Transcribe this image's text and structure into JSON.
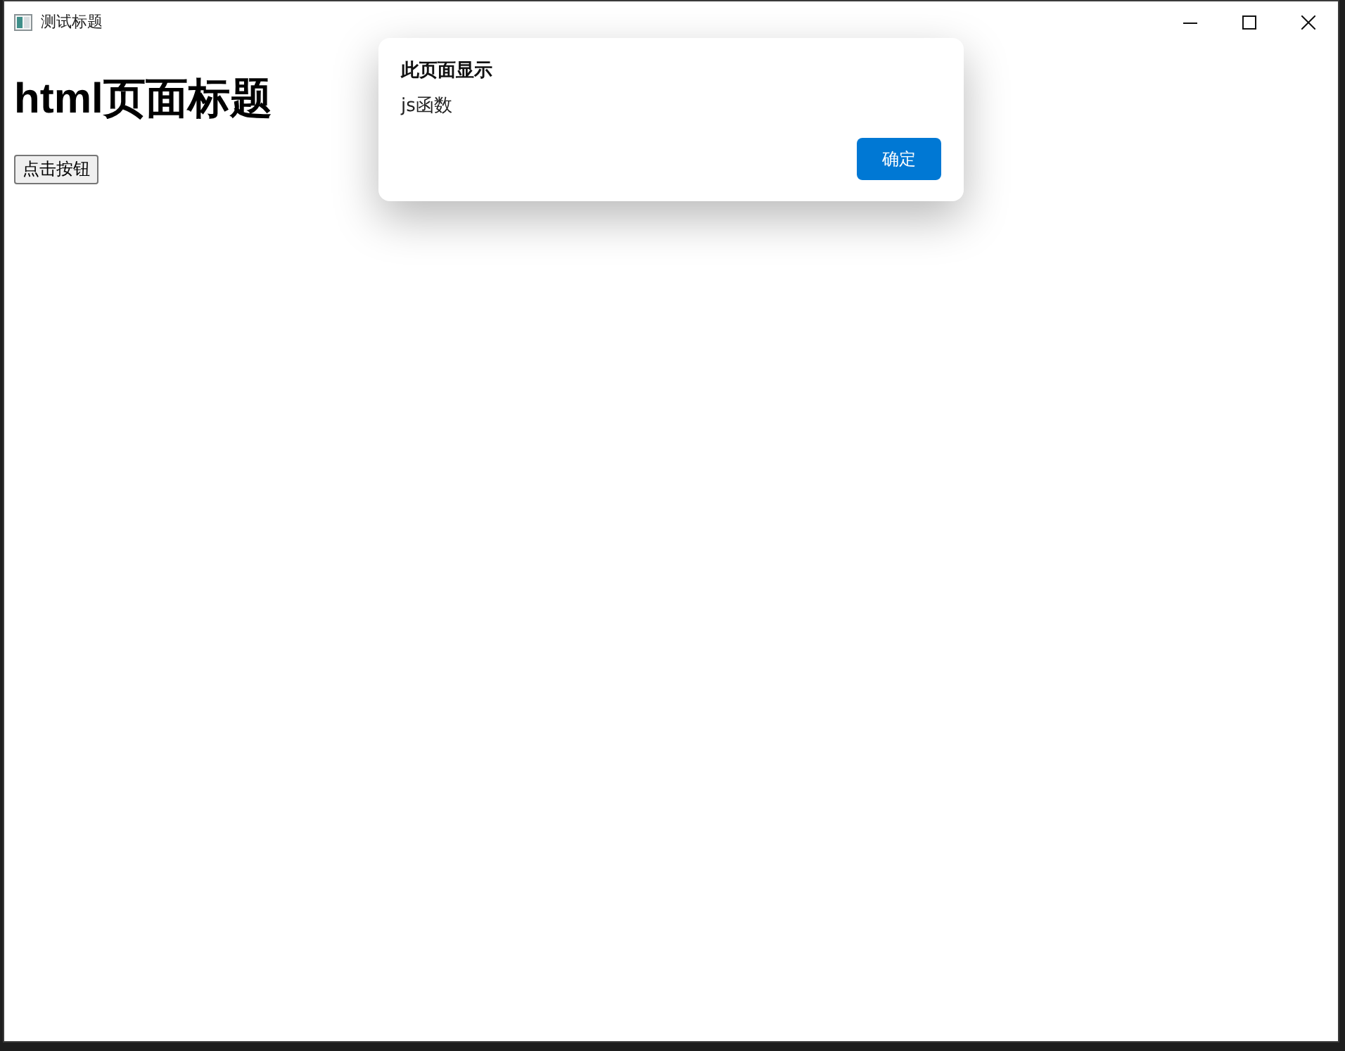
{
  "window": {
    "title": "测试标题"
  },
  "page": {
    "heading": "html页面标题",
    "button": "点击按钮"
  },
  "dialog": {
    "title": "此页面显示",
    "message": "js函数",
    "buttons": [
      "确定"
    ]
  }
}
